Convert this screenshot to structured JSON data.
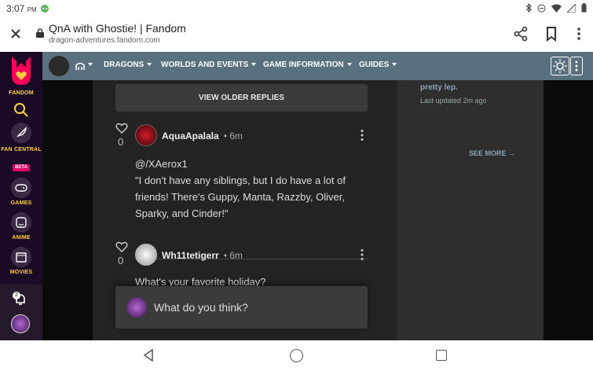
{
  "status_bar": {
    "time": "3:07",
    "ampm": "PM",
    "icons": [
      "android-icon",
      "bluetooth-icon",
      "dnd-icon",
      "wifi-icon",
      "signal-icon",
      "battery-icon"
    ]
  },
  "browser": {
    "title": "QnA with Ghostie! | Fandom",
    "url": "dragon-adventures.fandom.com"
  },
  "rail": {
    "fandom_label": "FANDOM",
    "fan_central_label": "FAN CENTRAL",
    "beta_label": "BETA",
    "games_label": "GAMES",
    "anime_label": "ANIME",
    "movies_label": "MOVIES",
    "notification_count": "2"
  },
  "community_nav": {
    "items": [
      "DRAGONS",
      "WORLDS AND EVENTS",
      "GAME INFORMATION",
      "GUIDES"
    ]
  },
  "thread": {
    "older_replies_label": "VIEW OLDER REPLIES",
    "replies": [
      {
        "likes": "0",
        "author": "AquaApalala",
        "time": "• 6m",
        "lines": [
          "@/XAerox1",
          "\"I don't have any siblings, but I do have a lot of",
          "friends! There's Guppy, Manta, Razzby, Oliver,",
          "Sparky, and Cinder!\""
        ]
      },
      {
        "likes": "0",
        "author": "Wh11tetigerr",
        "time": "• 6m",
        "lines": [
          "What's your favorite holiday?"
        ]
      }
    ],
    "compose_placeholder": "What do you think?"
  },
  "sidebar": {
    "snippet": "pretty lep.",
    "updated": "Last updated 2m ago",
    "see_more": "SEE MORE"
  },
  "colors": {
    "fandom_yellow": "#fecf3e",
    "fandom_pink": "#fa005a",
    "community_bar": "#59707f",
    "beta_badge": "#e30066"
  }
}
